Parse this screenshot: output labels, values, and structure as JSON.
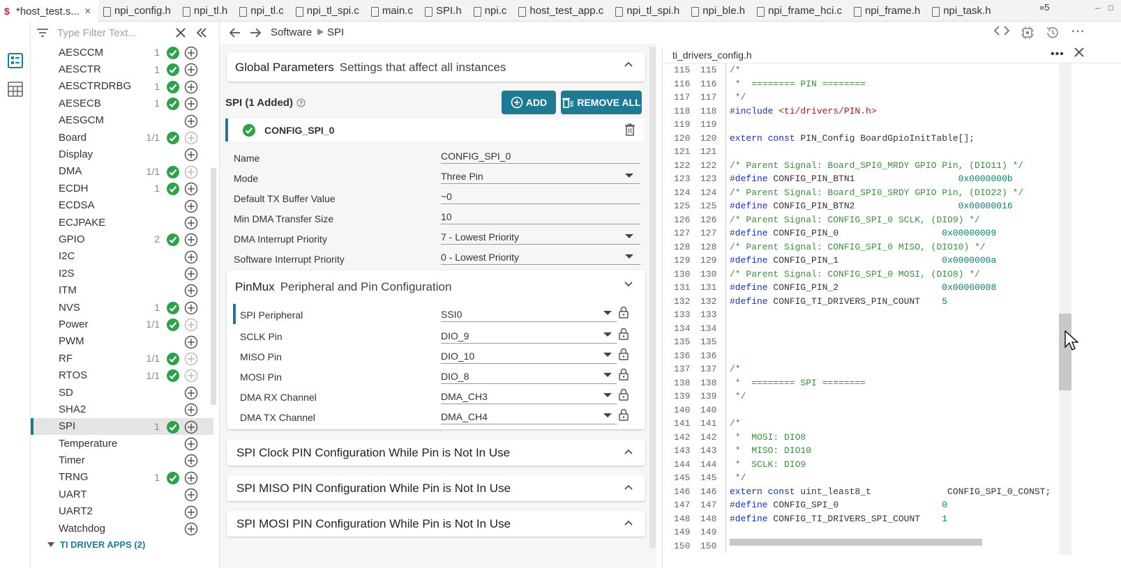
{
  "tabs": [
    {
      "label": "*host_test.s...",
      "active": true,
      "icon": "sysconfig-icon"
    },
    {
      "label": "npi_config.h"
    },
    {
      "label": "npi_tl.h"
    },
    {
      "label": "npi_tl.c"
    },
    {
      "label": "npi_tl_spi.c"
    },
    {
      "label": "main.c"
    },
    {
      "label": "SPI.h"
    },
    {
      "label": "npi.c"
    },
    {
      "label": "host_test_app.c"
    },
    {
      "label": "npi_tl_spi.h"
    },
    {
      "label": "npi_ble.h"
    },
    {
      "label": "npi_frame_hci.c"
    },
    {
      "label": "npi_frame.h"
    },
    {
      "label": "npi_task.h"
    }
  ],
  "tab_overflow": "»5",
  "filter": {
    "placeholder": "Type Filter Text..."
  },
  "tree": [
    {
      "name": "AESCCM",
      "count": "1",
      "ok": true
    },
    {
      "name": "AESCTR",
      "count": "1",
      "ok": true
    },
    {
      "name": "AESCTRDRBG",
      "count": "1",
      "ok": true
    },
    {
      "name": "AESECB",
      "count": "1",
      "ok": true
    },
    {
      "name": "AESGCM",
      "count": "",
      "ok": false
    },
    {
      "name": "Board",
      "count": "1/1",
      "ok": true,
      "dim": true
    },
    {
      "name": "Display",
      "count": "",
      "ok": false
    },
    {
      "name": "DMA",
      "count": "1/1",
      "ok": true,
      "dim": true
    },
    {
      "name": "ECDH",
      "count": "1",
      "ok": true
    },
    {
      "name": "ECDSA",
      "count": "",
      "ok": false
    },
    {
      "name": "ECJPAKE",
      "count": "",
      "ok": false
    },
    {
      "name": "GPIO",
      "count": "2",
      "ok": true
    },
    {
      "name": "I2C",
      "count": "",
      "ok": false
    },
    {
      "name": "I2S",
      "count": "",
      "ok": false
    },
    {
      "name": "ITM",
      "count": "",
      "ok": false
    },
    {
      "name": "NVS",
      "count": "1",
      "ok": true
    },
    {
      "name": "Power",
      "count": "1/1",
      "ok": true,
      "dim": true
    },
    {
      "name": "PWM",
      "count": "",
      "ok": false
    },
    {
      "name": "RF",
      "count": "1/1",
      "ok": true,
      "dim": true
    },
    {
      "name": "RTOS",
      "count": "1/1",
      "ok": true,
      "dim": true
    },
    {
      "name": "SD",
      "count": "",
      "ok": false
    },
    {
      "name": "SHA2",
      "count": "",
      "ok": false
    },
    {
      "name": "SPI",
      "count": "1",
      "ok": true,
      "selected": true
    },
    {
      "name": "Temperature",
      "count": "",
      "ok": false
    },
    {
      "name": "Timer",
      "count": "",
      "ok": false
    },
    {
      "name": "TRNG",
      "count": "1",
      "ok": true
    },
    {
      "name": "UART",
      "count": "",
      "ok": false
    },
    {
      "name": "UART2",
      "count": "",
      "ok": false
    },
    {
      "name": "Watchdog",
      "count": "",
      "ok": false
    }
  ],
  "tree_apps": "TI DRIVER APPS (2)",
  "breadcrumb": {
    "a": "Software",
    "b": "SPI"
  },
  "global": {
    "title": "Global Parameters",
    "subtitle": "Settings that affect all instances"
  },
  "section": {
    "title": "SPI (1 Added)",
    "add": "ADD",
    "remove_all": "REMOVE ALL"
  },
  "instance": {
    "name": "CONFIG_SPI_0"
  },
  "params": [
    {
      "label": "Name",
      "value": "CONFIG_SPI_0",
      "dropdown": false
    },
    {
      "label": "Mode",
      "value": "Three Pin",
      "dropdown": true
    },
    {
      "label": "Default TX Buffer Value",
      "value": "~0",
      "dropdown": false
    },
    {
      "label": "Min DMA Transfer Size",
      "value": "10",
      "dropdown": false
    },
    {
      "label": "DMA Interrupt Priority",
      "value": "7 - Lowest Priority",
      "dropdown": true
    },
    {
      "label": "Software Interrupt Priority",
      "value": "0 - Lowest Priority",
      "dropdown": true
    }
  ],
  "pinmux": {
    "title": "PinMux",
    "subtitle": "Peripheral and Pin Configuration",
    "rows": [
      {
        "label": "SPI Peripheral",
        "value": "SSI0"
      },
      {
        "label": "SCLK Pin",
        "value": "DIO_9"
      },
      {
        "label": "MISO Pin",
        "value": "DIO_10"
      },
      {
        "label": "MOSI Pin",
        "value": "DIO_8"
      },
      {
        "label": "DMA RX Channel",
        "value": "DMA_CH3"
      },
      {
        "label": "DMA TX Channel",
        "value": "DMA_CH4"
      }
    ]
  },
  "collapsed_sections": [
    "SPI Clock PIN Configuration While Pin is Not In Use",
    "SPI MISO PIN Configuration While Pin is Not In Use",
    "SPI MOSI PIN Configuration While Pin is Not In Use"
  ],
  "editor": {
    "filename": "ti_drivers_config.h",
    "more": "•••",
    "lines": [
      {
        "n": "115",
        "t": "/*",
        "c": "cm"
      },
      {
        "n": "116",
        "t": " *  ======== PIN ========",
        "c": "cm"
      },
      {
        "n": "117",
        "t": " */",
        "c": "cm"
      },
      {
        "n": "118",
        "t": "#include <ti/drivers/PIN.h>",
        "c": "inc"
      },
      {
        "n": "119",
        "t": "",
        "c": ""
      },
      {
        "n": "120",
        "t": "extern const PIN_Config BoardGpioInitTable[];",
        "c": "ext"
      },
      {
        "n": "121",
        "t": "",
        "c": ""
      },
      {
        "n": "122",
        "t": "/* Parent Signal: Board_SPI0_MRDY GPIO Pin, (DIO11) */",
        "c": "cm"
      },
      {
        "n": "123",
        "t": "#define CONFIG_PIN_BTN1                   0x0000000b",
        "c": "def"
      },
      {
        "n": "124",
        "t": "/* Parent Signal: Board_SPI0_SRDY GPIO Pin, (DIO22) */",
        "c": "cm"
      },
      {
        "n": "125",
        "t": "#define CONFIG_PIN_BTN2                   0x00000016",
        "c": "def"
      },
      {
        "n": "126",
        "t": "/* Parent Signal: CONFIG_SPI_0 SCLK, (DIO9) */",
        "c": "cm"
      },
      {
        "n": "127",
        "t": "#define CONFIG_PIN_0                   0x00000009",
        "c": "def"
      },
      {
        "n": "128",
        "t": "/* Parent Signal: CONFIG_SPI_0 MISO, (DIO10) */",
        "c": "cm"
      },
      {
        "n": "129",
        "t": "#define CONFIG_PIN_1                   0x0000000a",
        "c": "def"
      },
      {
        "n": "130",
        "t": "/* Parent Signal: CONFIG_SPI_0 MOSI, (DIO8) */",
        "c": "cm"
      },
      {
        "n": "131",
        "t": "#define CONFIG_PIN_2                   0x00000008",
        "c": "def"
      },
      {
        "n": "132",
        "t": "#define CONFIG_TI_DRIVERS_PIN_COUNT    5",
        "c": "def"
      },
      {
        "n": "133",
        "t": "",
        "c": ""
      },
      {
        "n": "134",
        "t": "",
        "c": ""
      },
      {
        "n": "135",
        "t": "",
        "c": ""
      },
      {
        "n": "136",
        "t": "",
        "c": ""
      },
      {
        "n": "137",
        "t": "/*",
        "c": "cm"
      },
      {
        "n": "138",
        "t": " *  ======== SPI ========",
        "c": "cm"
      },
      {
        "n": "139",
        "t": " */",
        "c": "cm"
      },
      {
        "n": "140",
        "t": "",
        "c": ""
      },
      {
        "n": "141",
        "t": "/*",
        "c": "cm"
      },
      {
        "n": "142",
        "t": " *  MOSI: DIO8",
        "c": "cm"
      },
      {
        "n": "143",
        "t": " *  MISO: DIO10",
        "c": "cm"
      },
      {
        "n": "144",
        "t": " *  SCLK: DIO9",
        "c": "cm"
      },
      {
        "n": "145",
        "t": " */",
        "c": "cm"
      },
      {
        "n": "146",
        "t": "extern const uint_least8_t              CONFIG_SPI_0_CONST;",
        "c": "ext2"
      },
      {
        "n": "147",
        "t": "#define CONFIG_SPI_0                   0",
        "c": "def"
      },
      {
        "n": "148",
        "t": "#define CONFIG_TI_DRIVERS_SPI_COUNT    1",
        "c": "def"
      },
      {
        "n": "149",
        "t": "",
        "c": ""
      },
      {
        "n": "150",
        "t": "",
        "c": ""
      }
    ]
  },
  "colors": {
    "accent": "#1f7a94",
    "ok": "#2ea24a",
    "comment": "#3f8a3f",
    "keyword": "#1a2fa6"
  }
}
